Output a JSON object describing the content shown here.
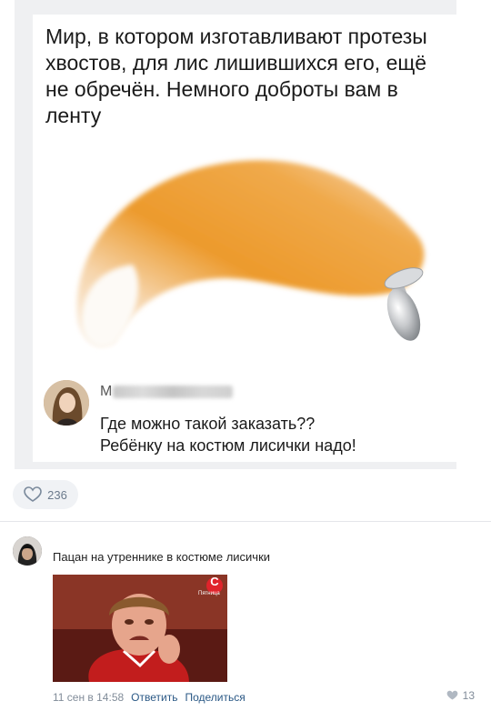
{
  "post": {
    "meme_text": "Мир, в котором изготавливают протезы хвостов, для лис лишившихся его, ещё не обречён. Немного доброты вам в ленту",
    "comment_name_initial": "М",
    "comment_text_line1": "Где можно такой заказать??",
    "comment_text_line2": "Ребёнку на костюм лисички надо!",
    "likes": "236"
  },
  "comment": {
    "text": "Пацан на утреннике в костюме лисички",
    "image_badge": "С",
    "image_caption": "Пятница",
    "date": "11 сен в 14:58",
    "reply_label": "Ответить",
    "share_label": "Поделиться",
    "likes": "13"
  },
  "colors": {
    "link": "#2a5885",
    "meta": "#818c99",
    "fox_orange": "#e98f1c"
  }
}
